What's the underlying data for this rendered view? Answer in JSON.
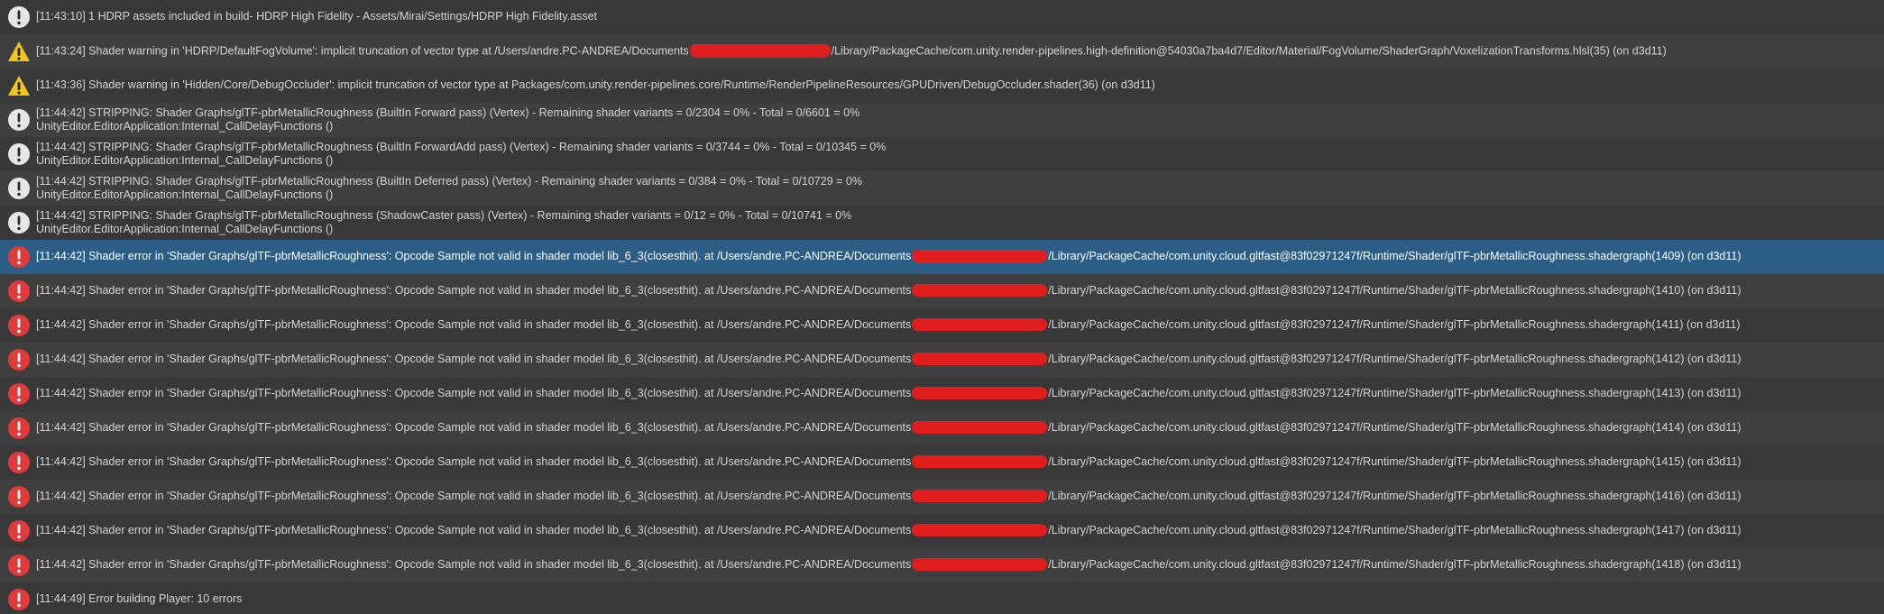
{
  "colors": {
    "background": "#383838",
    "row_alt": "#3f3f3f",
    "selected": "#2c5d87",
    "info_icon": "#e6e6e6",
    "warning_icon": "#f5c518",
    "error_icon": "#e03a3a",
    "redaction": "#e01e1e"
  },
  "entries": [
    {
      "type": "info",
      "icon": "exclamation-circle-icon",
      "line1": "[11:43:10] 1 HDRP assets included in build- HDRP High Fidelity - Assets/Mirai/Settings/HDRP High Fidelity.asset",
      "line2": ""
    },
    {
      "type": "warning",
      "icon": "warning-triangle-icon",
      "line1": "[11:43:24] Shader warning in 'HDRP/DefaultFogVolume': implicit truncation of vector type at /Users/andre.PC-ANDREA/Documents",
      "redacted": true,
      "line1_tail": "/Library/PackageCache/com.unity.render-pipelines.high-definition@54030a7ba4d7/Editor/Material/FogVolume/ShaderGraph/VoxelizationTransforms.hlsl(35) (on d3d11)",
      "line2": ""
    },
    {
      "type": "warning",
      "icon": "warning-triangle-icon",
      "line1": "[11:43:36] Shader warning in 'Hidden/Core/DebugOccluder': implicit truncation of vector type at Packages/com.unity.render-pipelines.core/Runtime/RenderPipelineResources/GPUDriven/DebugOccluder.shader(36) (on d3d11)",
      "line2": ""
    },
    {
      "type": "info",
      "icon": "exclamation-circle-icon",
      "line1": "[11:44:42] STRIPPING: Shader Graphs/glTF-pbrMetallicRoughness (BuiltIn Forward pass) (Vertex) - Remaining shader variants = 0/2304 = 0% - Total = 0/6601 = 0%",
      "line2": "UnityEditor.EditorApplication:Internal_CallDelayFunctions ()"
    },
    {
      "type": "info",
      "icon": "exclamation-circle-icon",
      "line1": "[11:44:42] STRIPPING: Shader Graphs/glTF-pbrMetallicRoughness (BuiltIn ForwardAdd pass) (Vertex) - Remaining shader variants = 0/3744 = 0% - Total = 0/10345 = 0%",
      "line2": "UnityEditor.EditorApplication:Internal_CallDelayFunctions ()"
    },
    {
      "type": "info",
      "icon": "exclamation-circle-icon",
      "line1": "[11:44:42] STRIPPING: Shader Graphs/glTF-pbrMetallicRoughness (BuiltIn Deferred pass) (Vertex) - Remaining shader variants = 0/384 = 0% - Total = 0/10729 = 0%",
      "line2": "UnityEditor.EditorApplication:Internal_CallDelayFunctions ()"
    },
    {
      "type": "info",
      "icon": "exclamation-circle-icon",
      "line1": "[11:44:42] STRIPPING: Shader Graphs/glTF-pbrMetallicRoughness (ShadowCaster pass) (Vertex) - Remaining shader variants = 0/12 = 0% - Total = 0/10741 = 0%",
      "line2": "UnityEditor.EditorApplication:Internal_CallDelayFunctions ()"
    },
    {
      "type": "error",
      "icon": "error-circle-icon",
      "selected": true,
      "line1": "[11:44:42] Shader error in 'Shader Graphs/glTF-pbrMetallicRoughness': Opcode Sample not valid in shader model lib_6_3(closesthit). at /Users/andre.PC-ANDREA/Documents",
      "redacted": true,
      "line1_tail": "/Library/PackageCache/com.unity.cloud.gltfast@83f02971247f/Runtime/Shader/glTF-pbrMetallicRoughness.shadergraph(1409) (on d3d11)",
      "line2": ""
    },
    {
      "type": "error",
      "icon": "error-circle-icon",
      "line1": "[11:44:42] Shader error in 'Shader Graphs/glTF-pbrMetallicRoughness': Opcode Sample not valid in shader model lib_6_3(closesthit). at /Users/andre.PC-ANDREA/Documents",
      "redacted": true,
      "line1_tail": "/Library/PackageCache/com.unity.cloud.gltfast@83f02971247f/Runtime/Shader/glTF-pbrMetallicRoughness.shadergraph(1410) (on d3d11)",
      "line2": ""
    },
    {
      "type": "error",
      "icon": "error-circle-icon",
      "line1": "[11:44:42] Shader error in 'Shader Graphs/glTF-pbrMetallicRoughness': Opcode Sample not valid in shader model lib_6_3(closesthit). at /Users/andre.PC-ANDREA/Documents",
      "redacted": true,
      "line1_tail": "/Library/PackageCache/com.unity.cloud.gltfast@83f02971247f/Runtime/Shader/glTF-pbrMetallicRoughness.shadergraph(1411) (on d3d11)",
      "line2": ""
    },
    {
      "type": "error",
      "icon": "error-circle-icon",
      "line1": "[11:44:42] Shader error in 'Shader Graphs/glTF-pbrMetallicRoughness': Opcode Sample not valid in shader model lib_6_3(closesthit). at /Users/andre.PC-ANDREA/Documents",
      "redacted": true,
      "line1_tail": "/Library/PackageCache/com.unity.cloud.gltfast@83f02971247f/Runtime/Shader/glTF-pbrMetallicRoughness.shadergraph(1412) (on d3d11)",
      "line2": ""
    },
    {
      "type": "error",
      "icon": "error-circle-icon",
      "line1": "[11:44:42] Shader error in 'Shader Graphs/glTF-pbrMetallicRoughness': Opcode Sample not valid in shader model lib_6_3(closesthit). at /Users/andre.PC-ANDREA/Documents",
      "redacted": true,
      "line1_tail": "/Library/PackageCache/com.unity.cloud.gltfast@83f02971247f/Runtime/Shader/glTF-pbrMetallicRoughness.shadergraph(1413) (on d3d11)",
      "line2": ""
    },
    {
      "type": "error",
      "icon": "error-circle-icon",
      "line1": "[11:44:42] Shader error in 'Shader Graphs/glTF-pbrMetallicRoughness': Opcode Sample not valid in shader model lib_6_3(closesthit). at /Users/andre.PC-ANDREA/Documents",
      "redacted": true,
      "line1_tail": "/Library/PackageCache/com.unity.cloud.gltfast@83f02971247f/Runtime/Shader/glTF-pbrMetallicRoughness.shadergraph(1414) (on d3d11)",
      "line2": ""
    },
    {
      "type": "error",
      "icon": "error-circle-icon",
      "line1": "[11:44:42] Shader error in 'Shader Graphs/glTF-pbrMetallicRoughness': Opcode Sample not valid in shader model lib_6_3(closesthit). at /Users/andre.PC-ANDREA/Documents",
      "redacted": true,
      "line1_tail": "/Library/PackageCache/com.unity.cloud.gltfast@83f02971247f/Runtime/Shader/glTF-pbrMetallicRoughness.shadergraph(1415) (on d3d11)",
      "line2": ""
    },
    {
      "type": "error",
      "icon": "error-circle-icon",
      "line1": "[11:44:42] Shader error in 'Shader Graphs/glTF-pbrMetallicRoughness': Opcode Sample not valid in shader model lib_6_3(closesthit). at /Users/andre.PC-ANDREA/Documents",
      "redacted": true,
      "line1_tail": "/Library/PackageCache/com.unity.cloud.gltfast@83f02971247f/Runtime/Shader/glTF-pbrMetallicRoughness.shadergraph(1416) (on d3d11)",
      "line2": ""
    },
    {
      "type": "error",
      "icon": "error-circle-icon",
      "line1": "[11:44:42] Shader error in 'Shader Graphs/glTF-pbrMetallicRoughness': Opcode Sample not valid in shader model lib_6_3(closesthit). at /Users/andre.PC-ANDREA/Documents",
      "redacted": true,
      "line1_tail": "/Library/PackageCache/com.unity.cloud.gltfast@83f02971247f/Runtime/Shader/glTF-pbrMetallicRoughness.shadergraph(1417) (on d3d11)",
      "line2": ""
    },
    {
      "type": "error",
      "icon": "error-circle-icon",
      "line1": "[11:44:42] Shader error in 'Shader Graphs/glTF-pbrMetallicRoughness': Opcode Sample not valid in shader model lib_6_3(closesthit). at /Users/andre.PC-ANDREA/Documents",
      "redacted": true,
      "line1_tail": "/Library/PackageCache/com.unity.cloud.gltfast@83f02971247f/Runtime/Shader/glTF-pbrMetallicRoughness.shadergraph(1418) (on d3d11)",
      "line2": ""
    },
    {
      "type": "error",
      "icon": "error-circle-icon",
      "line1": "[11:44:49] Error building Player: 10 errors",
      "line2": ""
    }
  ]
}
